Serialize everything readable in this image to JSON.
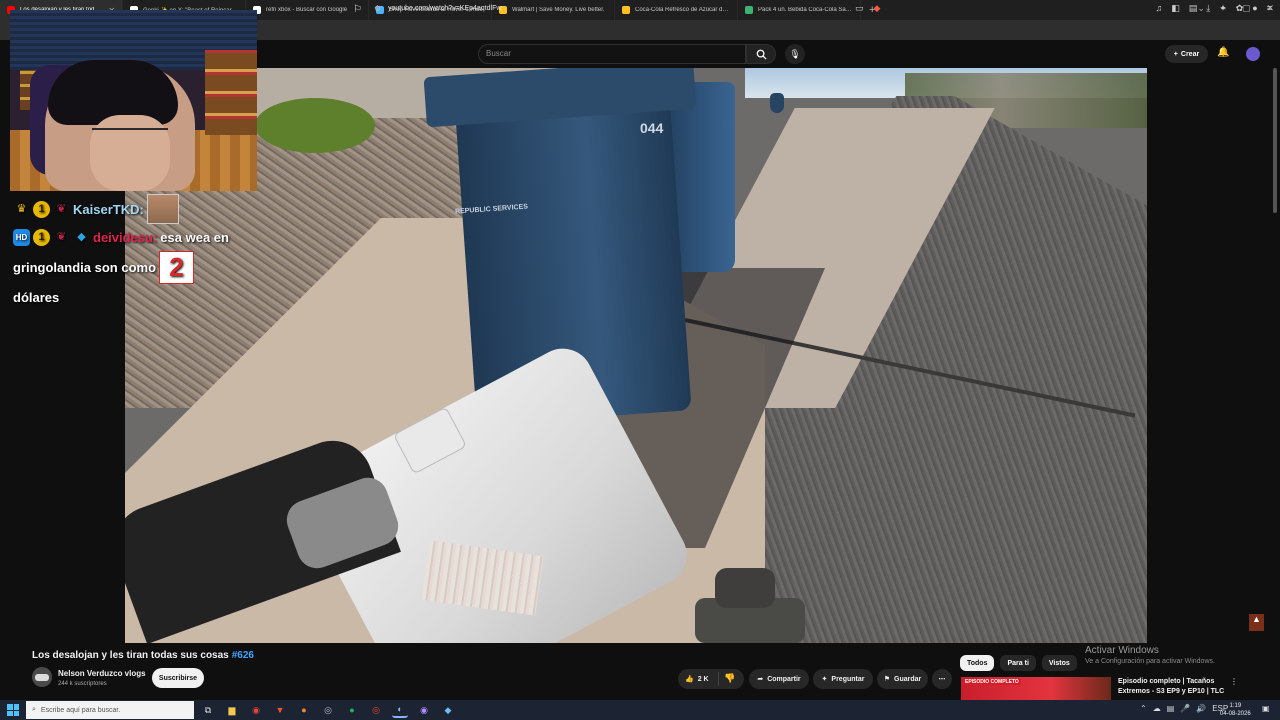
{
  "browser": {
    "tabs": [
      {
        "title": "Los desalojan y les tiran todas su",
        "icon": "youtube-icon",
        "color": "#ff0000",
        "active": true
      },
      {
        "title": "Genki ✨ en X: \"Beast of Reincarnati",
        "icon": "x-icon",
        "color": "#ffffff",
        "active": false
      },
      {
        "title": "refri xbox - Buscar con Google",
        "icon": "google-icon",
        "color": "#ffffff",
        "active": false
      },
      {
        "title": "Shop Hoverboards at Hover-1 Ride",
        "icon": "shopify-icon",
        "color": "#4ab3ff",
        "active": false
      },
      {
        "title": "Walmart | Save Money. Live better.",
        "icon": "walmart-icon",
        "color": "#ffc220",
        "active": false
      },
      {
        "title": "Coca-Cola Refresco de Azúcar de Ca",
        "icon": "store-icon",
        "color": "#ffc220",
        "active": false
      },
      {
        "title": "Pack 4 un. Bebida Coca-Cola Sabor",
        "icon": "store-icon",
        "color": "#3cb371",
        "active": false
      }
    ],
    "new_tab": "+",
    "url": "youtube.com/watch?v=KEp4aqtdlFw"
  },
  "youtube": {
    "search_placeholder": "Buscar",
    "create_label": "Crear",
    "video_title": "Los desalojan y les tiran todas sus cosas",
    "hashtag": "#626",
    "channel_name": "Nelson Verduzco vlogs",
    "subscribers": "244 k suscriptores",
    "subscribe_label": "Suscribirse",
    "like_count": "2 K",
    "share_label": "Compartir",
    "ask_label": "Preguntar",
    "save_label": "Guardar",
    "chips": [
      "Todos",
      "Para ti",
      "Vistos"
    ],
    "recommendation": {
      "badge": "EPISODIO COMPLETO",
      "title": "Episodio completo | Tacaños Extremos - S3 EP9 y EP10 | TLC ..."
    }
  },
  "video_overlay": {
    "bin_logo": "REPUBLIC SERVICES",
    "bin_number": "044",
    "emote_number": "2"
  },
  "chat": {
    "messages": [
      {
        "user": "KaiserTKD:",
        "text": "",
        "badges": [
          "crown-icon",
          "1",
          "rose-icon"
        ]
      },
      {
        "user": "deividesu:",
        "text_a": "esa wea en",
        "text_b": "gringolandia son como",
        "text_c": "dólares",
        "badges": [
          "hd-icon",
          "1",
          "rose-icon",
          "gem-icon"
        ]
      }
    ],
    "badge_number": "1"
  },
  "windows": {
    "activate_title": "Activar Windows",
    "activate_sub": "Ve a Configuración para activar Windows.",
    "search_placeholder": "Escribe aquí para buscar.",
    "lang": "ESP",
    "time": "1:19",
    "date": "04-08-2026"
  }
}
